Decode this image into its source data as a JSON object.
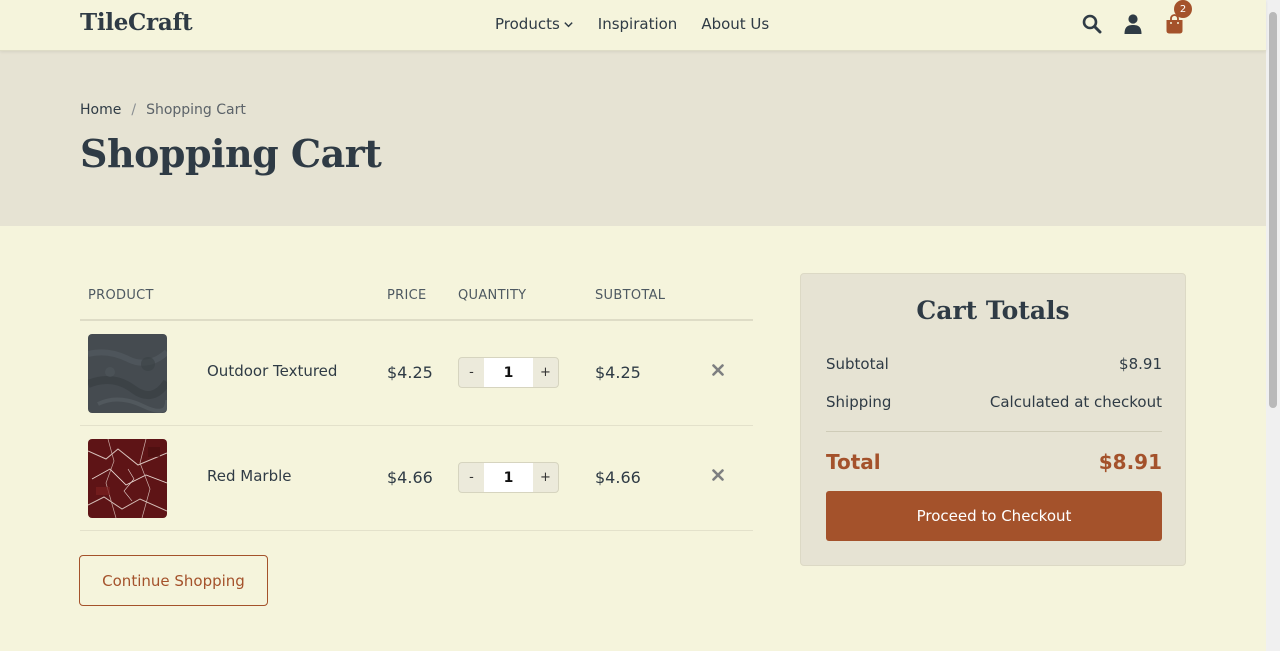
{
  "header": {
    "brand": "TileCraft",
    "nav": [
      {
        "label": "Products",
        "has_dropdown": true
      },
      {
        "label": "Inspiration",
        "has_dropdown": false
      },
      {
        "label": "About Us",
        "has_dropdown": false
      }
    ],
    "icons": [
      "search-icon",
      "user-icon",
      "shopping-bag-icon"
    ],
    "cart_count": "2"
  },
  "breadcrumb": {
    "home": "Home",
    "separator": "/",
    "current": "Shopping Cart"
  },
  "page_title": "Shopping Cart",
  "table": {
    "headers": {
      "product": "PRODUCT",
      "price": "PRICE",
      "quantity": "QUANTITY",
      "subtotal": "SUBTOTAL"
    },
    "rows": [
      {
        "name": "Outdoor Textured",
        "price": "$4.25",
        "qty": "1",
        "subtotal": "$4.25",
        "thumb": "dark-slate-tile"
      },
      {
        "name": "Red Marble",
        "price": "$4.66",
        "qty": "1",
        "subtotal": "$4.66",
        "thumb": "red-marble-tile"
      }
    ],
    "qty_minus": "-",
    "qty_plus": "+"
  },
  "continue_label": "Continue Shopping",
  "totals": {
    "title": "Cart Totals",
    "subtotal_label": "Subtotal",
    "subtotal_value": "$8.91",
    "shipping_label": "Shipping",
    "shipping_value": "Calculated at checkout",
    "total_label": "Total",
    "total_value": "$8.91",
    "checkout_label": "Proceed to Checkout"
  },
  "colors": {
    "background": "#f5f4dc",
    "hero": "#e6e3d3",
    "accent": "#a4522b",
    "text": "#2f3b45"
  }
}
